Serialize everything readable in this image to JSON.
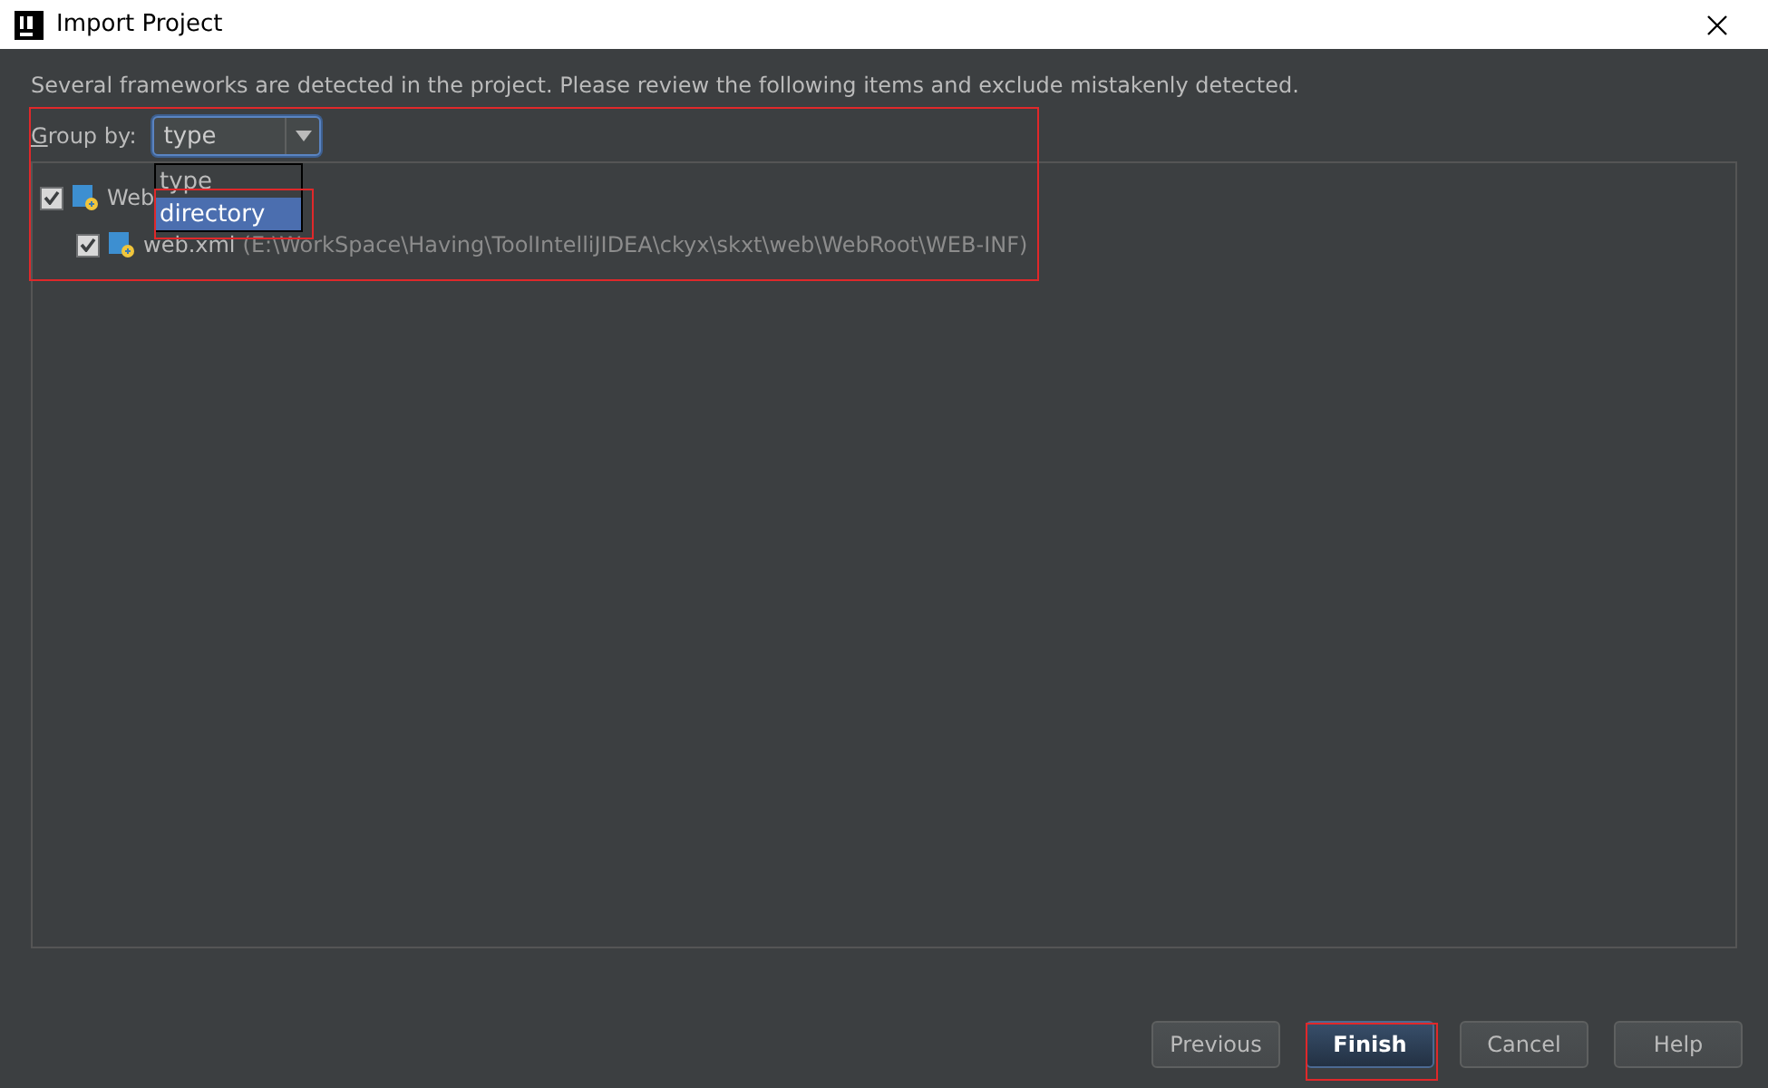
{
  "window": {
    "title": "Import Project"
  },
  "description": "Several frameworks are detected in the project. Please review the following items and exclude mistakenly detected.",
  "group_by": {
    "label": "Group by:",
    "value": "type",
    "expanded": true,
    "options": [
      {
        "label": "type",
        "highlighted": false
      },
      {
        "label": "directory",
        "highlighted": true
      }
    ]
  },
  "tree": [
    {
      "label": "Web",
      "checked": true,
      "children": [
        {
          "label": "web.xml",
          "path": "(E:\\WorkSpace\\Having\\ToolIntelliJIDEA\\ckyx\\skxt\\web\\WebRoot\\WEB-INF)",
          "checked": true
        }
      ]
    }
  ],
  "buttons": [
    {
      "label": "Previous",
      "kind": "normal"
    },
    {
      "label": "Finish",
      "kind": "default"
    },
    {
      "label": "Cancel",
      "kind": "normal"
    },
    {
      "label": "Help",
      "kind": "normal"
    }
  ]
}
